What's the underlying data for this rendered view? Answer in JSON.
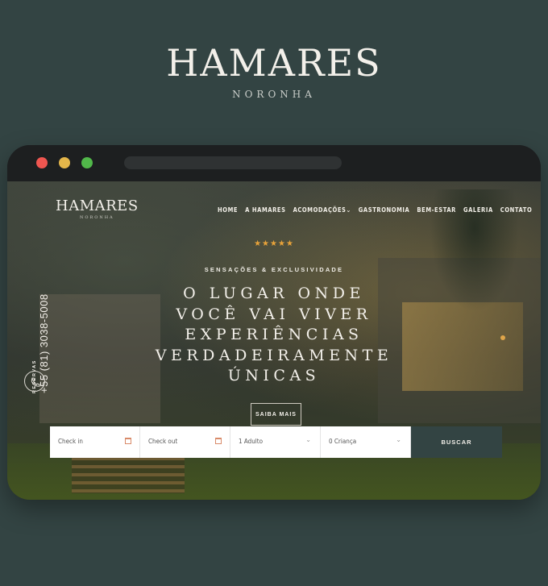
{
  "brand": {
    "name": "HAMARES",
    "subtitle": "NORONHA"
  },
  "site": {
    "logo_name": "HAMARES",
    "logo_sub": "NORONHA",
    "nav": [
      "HOME",
      "A HAMARES",
      "ACOMODAÇÕES",
      "GASTRONOMIA",
      "BEM-ESTAR",
      "GALERIA",
      "CONTATO"
    ],
    "nav_dropdown_marker": "⌄"
  },
  "contact": {
    "label": "RESERVAS",
    "phone": "+55 (81) 3038-5008"
  },
  "hero": {
    "stars": "★★★★★",
    "tagline": "SENSAÇÕES & EXCLUSIVIDADE",
    "headline": [
      "O LUGAR ONDE",
      "VOCÊ VAI VIVER",
      "EXPERIÊNCIAS",
      "VERDADEIRAMENTE",
      "ÚNICAS"
    ],
    "cta": "SAIBA MAIS"
  },
  "booking": {
    "checkin": "Check in",
    "checkout": "Check out",
    "adults": "1 Adulto",
    "children": "0 Criança",
    "search": "BUSCAR"
  },
  "colors": {
    "accent": "#e8a33a",
    "background": "#334443",
    "frame": "#1d1f20"
  }
}
